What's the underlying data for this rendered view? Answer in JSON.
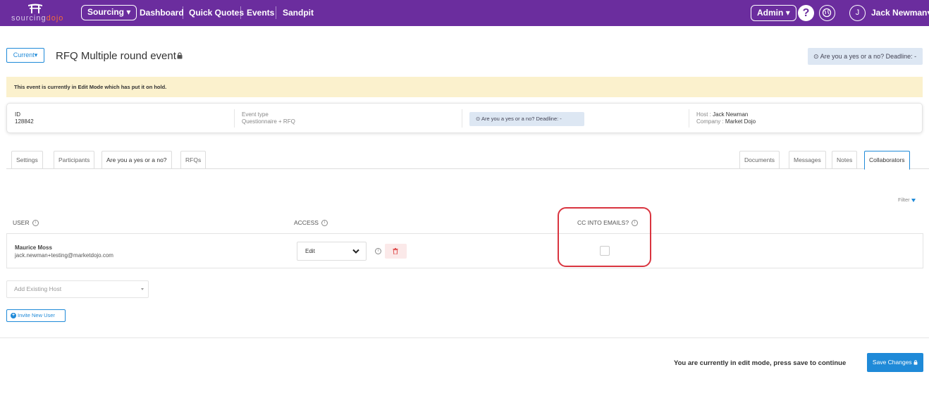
{
  "nav": {
    "logo_text_start": "sourcing",
    "logo_text_accent": "dojo",
    "sourcing_label": "Sourcing",
    "links": [
      "Dashboard",
      "Quick Quotes",
      "Events",
      "Sandpit"
    ],
    "admin_label": "Admin",
    "help_label": "?",
    "avatar_initial": "J",
    "user_name": "Jack Newman",
    "colors": {
      "bar": "#6b2d9e",
      "logo_accent": "#f26b3a"
    }
  },
  "header": {
    "current_label": "Current",
    "event_title": "RFQ Multiple round event",
    "deadline_label": "Are you a yes or a no? Deadline: -"
  },
  "warning": {
    "text": "This event is currently in Edit Mode which has put it on hold."
  },
  "info_card": {
    "id_label": "ID",
    "id_value": "128842",
    "event_type_label": "Event type",
    "event_type_value": "Questionnaire + RFQ",
    "deadline_label": "Are you a yes or a no? Deadline: -",
    "host_label": "Host",
    "host_value": "Jack Newman",
    "company_label": "Company",
    "company_value": "Market Dojo"
  },
  "tabs": {
    "left": [
      "Settings",
      "Participants",
      "Are you a yes or a no?",
      "RFQs"
    ],
    "right": [
      "Documents",
      "Messages",
      "Notes",
      "Collaborators"
    ],
    "active": "Collaborators"
  },
  "collaborators": {
    "filter_label": "Filter",
    "columns": {
      "user": "USER",
      "access": "ACCESS",
      "cc": "CC INTO EMAILS?"
    },
    "rows": [
      {
        "name": "Maurice Moss",
        "email": "jack.newman+testing@marketdojo.com",
        "access": "Edit",
        "cc_into_emails": false
      }
    ],
    "add_host_placeholder": "Add Existing Host",
    "invite_label": "Invite New User"
  },
  "footer": {
    "edit_message": "You are currently in edit mode, press save to continue",
    "save_label": "Save Changes",
    "colors": {
      "primary": "#1f8ad8",
      "highlight": "#d9343f",
      "warning_bg": "#fbf1cd"
    }
  }
}
